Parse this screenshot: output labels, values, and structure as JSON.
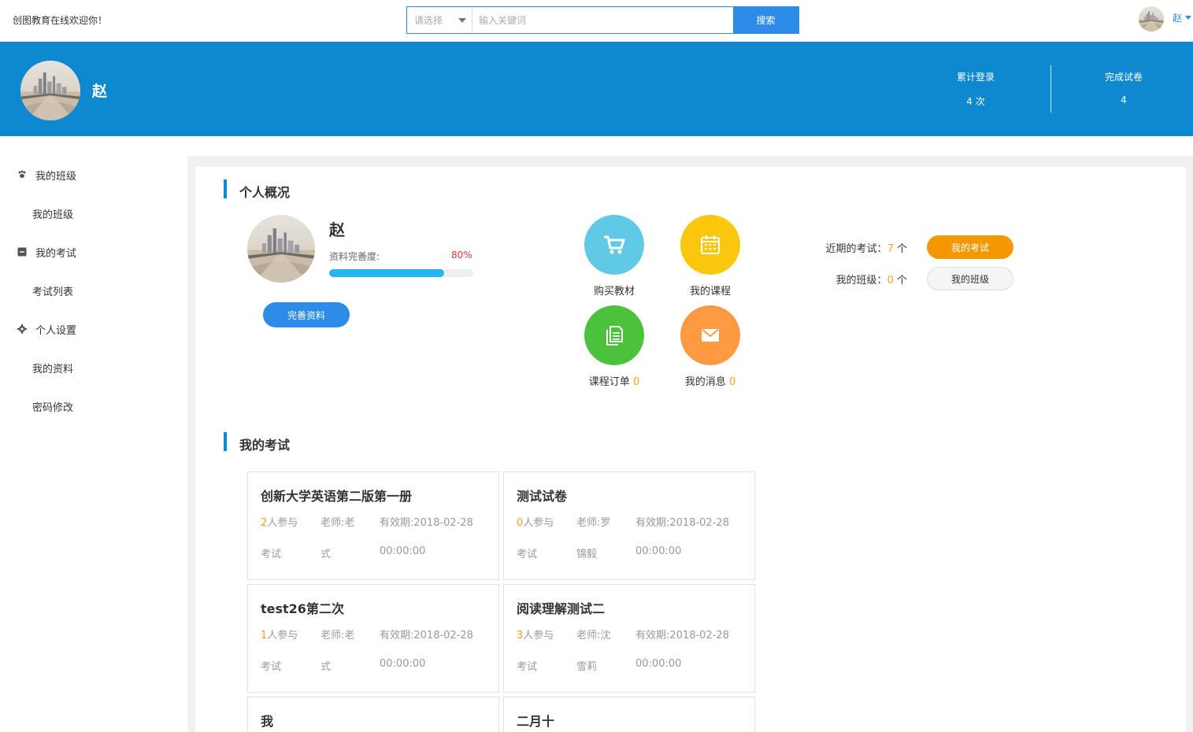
{
  "header": {
    "welcome": "创图教育在线欢迎你！",
    "search_select": "请选择",
    "search_placeholder": "输入关键词",
    "search_button": "搜索",
    "user_name": "赵"
  },
  "banner": {
    "name": "赵",
    "stats": [
      {
        "label": "累计登录",
        "value": "4 次"
      },
      {
        "label": "完成试卷",
        "value": "4"
      }
    ]
  },
  "sidebar": {
    "items": [
      {
        "label": "我的班级",
        "icon": "paw-icon",
        "type": "group"
      },
      {
        "label": "我的班级",
        "type": "link"
      },
      {
        "label": "我的考试",
        "icon": "minus-square-icon",
        "type": "group"
      },
      {
        "label": "考试列表",
        "type": "link"
      },
      {
        "label": "个人设置",
        "icon": "gear-icon",
        "type": "group"
      },
      {
        "label": "我的资料",
        "type": "link"
      },
      {
        "label": "密码修改",
        "type": "link"
      }
    ]
  },
  "overview": {
    "title": "个人概况",
    "name": "赵",
    "completeness_label": "资料完善度:",
    "completeness_pct": "80%",
    "completeness_value": 0.8,
    "complete_button": "完善资料",
    "quick": [
      {
        "label": "购买教材",
        "count": "",
        "icon": "cart-icon",
        "color": "#5fc9e6"
      },
      {
        "label": "我的课程",
        "count": "",
        "icon": "calendar-icon",
        "color": "#f9c80e"
      },
      {
        "label": "课程订单",
        "count": "0",
        "icon": "document-icon",
        "color": "#4cc23c"
      },
      {
        "label": "我的消息",
        "count": "0",
        "icon": "mail-icon",
        "color": "#fd9a42"
      }
    ],
    "recent_exam_label": "近期的考试：",
    "recent_exam_count": "7",
    "unit": "个",
    "my_class_label": "我的班级：",
    "my_class_count": "0",
    "my_exam_button": "我的考试",
    "my_class_button": "我的班级"
  },
  "exams": {
    "title": "我的考试",
    "participants_suffix": "人参与",
    "cards": [
      {
        "title": "创新大学英语第二版第一册",
        "count": "2",
        "teacher": "老师:老",
        "teacher2": "式",
        "valid": "有效期:2018-02-28",
        "type": "考试",
        "time": "00:00:00"
      },
      {
        "title": "测试试卷",
        "count": "0",
        "teacher": "老师:罗",
        "teacher2": "锦毅",
        "valid": "有效期:2018-02-28",
        "type": "考试",
        "time": "00:00:00"
      },
      {
        "title": "test26第二次",
        "count": "1",
        "teacher": "老师:老",
        "teacher2": "式",
        "valid": "有效期:2018-02-28",
        "type": "考试",
        "time": "00:00:00"
      },
      {
        "title": "阅读理解测试二",
        "count": "3",
        "teacher": "老师:沈",
        "teacher2": "雪莉",
        "valid": "有效期:2018-02-28",
        "type": "考试",
        "time": "00:00:00"
      },
      {
        "title": "我"
      },
      {
        "title": "二月十"
      }
    ]
  }
}
